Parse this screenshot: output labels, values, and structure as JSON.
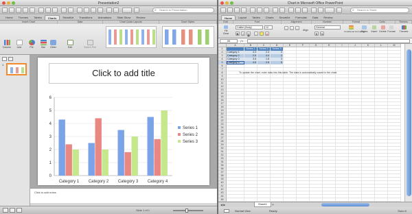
{
  "ppt": {
    "window_title": "Presentation2",
    "search_placeholder": "Search in Presentation",
    "tabs": [
      "Home",
      "Themes",
      "Tables",
      "Charts",
      "SmartArt",
      "Transitions",
      "Animations",
      "Slide Show",
      "Review"
    ],
    "active_tab": "Charts",
    "groups": [
      "Insert Chart",
      "Data",
      "Chart Quick Layouts",
      "Chart Styles"
    ],
    "chart_buttons": [
      "Column",
      "Line",
      "Pie",
      "Bar",
      "Other"
    ],
    "data_buttons": [
      "Edit",
      "Switch Plot"
    ],
    "slide_title": "Click to add title",
    "notes_placeholder": "Click to add notes",
    "slide_counter": "Slide 1 of 1"
  },
  "chart_data": {
    "type": "bar",
    "categories": [
      "Category 1",
      "Category 2",
      "Category 3",
      "Category 4"
    ],
    "series": [
      {
        "name": "Series 1",
        "values": [
          4.3,
          2.5,
          3.5,
          4.5
        ],
        "color": "#7ba3e8"
      },
      {
        "name": "Series 2",
        "values": [
          2.4,
          4.4,
          1.8,
          2.8
        ],
        "color": "#e98782"
      },
      {
        "name": "Series 3",
        "values": [
          2,
          2,
          3,
          5
        ],
        "color": "#c5e88c"
      }
    ],
    "yticks": [
      "0",
      "1",
      "2",
      "3",
      "4",
      "5",
      "6"
    ],
    "ylim": [
      0,
      6
    ],
    "legend": "right",
    "grid": true
  },
  "xl": {
    "window_title": "Chart in Microsoft Office PowerPoint",
    "search_placeholder": "Search in Sheet",
    "tabs": [
      "Home",
      "Layout",
      "Tables",
      "Charts",
      "SmartArt",
      "Formulas",
      "Data",
      "Review"
    ],
    "active_tab": "Home",
    "groups": [
      "Edit",
      "Font",
      "Alignment",
      "Number",
      "Format",
      "Cells",
      "Themes"
    ],
    "font_name": "Calibri (Body)",
    "font_size": "12",
    "number_format": "General",
    "ribbon_buttons": [
      "Fill",
      "Clear",
      "Align",
      "Conditional Formatting",
      "Styles",
      "Insert",
      "Delete",
      "Format",
      "Themes"
    ],
    "name_box": "A5",
    "columns": [
      "A",
      "B",
      "C",
      "D",
      "E",
      "F",
      "G",
      "H",
      "I",
      "J",
      "K",
      "L",
      "M"
    ],
    "table_headers": [
      "",
      "Series 1",
      "Series 2",
      "Series 3"
    ],
    "table_rows": [
      [
        "Category 1",
        "4.3",
        "2.4",
        "2"
      ],
      [
        "Category 2",
        "2.5",
        "4.4",
        "2"
      ],
      [
        "Category 3",
        "3.5",
        "1.8",
        "3"
      ],
      [
        "Category 4",
        "4.5",
        "2.8",
        "5"
      ]
    ],
    "hint": "To update the chart, enter data into this table. The data is automatically saved in the chart.",
    "sheet_tab": "Sheet1",
    "status_left": "Normal View",
    "status_mid": "Ready",
    "status_right": "Sum=0"
  }
}
